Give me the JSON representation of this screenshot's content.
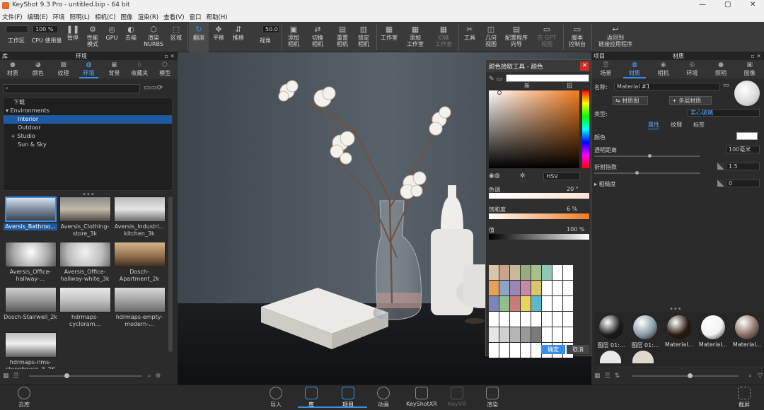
{
  "window": {
    "title": "KeyShot 9.3 Pro - untitled.bip - 64 bit",
    "controls": [
      "—",
      "▢",
      "✕"
    ]
  },
  "menu": [
    "文件(F)",
    "编辑(E)",
    "环境",
    "照明(L)",
    "相机(C)",
    "图像",
    "渲染(R)",
    "查看(V)",
    "窗口",
    "帮助(H)"
  ],
  "toolbar": {
    "cpu_value": "100 %",
    "fov_value": "50.0",
    "buttons": [
      {
        "label": "工作区",
        "icon": "workspace-icon"
      },
      {
        "label": "CPU 使用量",
        "icon": "cpu-icon"
      },
      {
        "label": "暂停",
        "icon": "pause-icon"
      },
      {
        "label": "性能\n模式",
        "icon": "performance-icon"
      },
      {
        "label": "GPU",
        "icon": "gpu-icon"
      },
      {
        "label": "去噪",
        "icon": "denoise-icon"
      },
      {
        "label": "渲染\nNURBS",
        "icon": "nurbs-icon"
      },
      {
        "label": "区域",
        "icon": "region-icon"
      },
      {
        "label": "翻滚",
        "icon": "tumble-icon"
      },
      {
        "label": "平移",
        "icon": "pan-icon"
      },
      {
        "label": "推移",
        "icon": "dolly-icon"
      },
      {
        "label": "视角",
        "icon": "fov-icon"
      },
      {
        "label": "添加\n相机",
        "icon": "add-camera-icon"
      },
      {
        "label": "切换\n相机",
        "icon": "switch-camera-icon"
      },
      {
        "label": "重置\n相机",
        "icon": "reset-camera-icon"
      },
      {
        "label": "锁定\n相机",
        "icon": "lock-camera-icon"
      },
      {
        "label": "工作室",
        "icon": "studio-icon"
      },
      {
        "label": "添加\n工作室",
        "icon": "add-studio-icon"
      },
      {
        "label": "切换\n工作室",
        "icon": "switch-studio-icon"
      },
      {
        "label": "工具",
        "icon": "tools-icon"
      },
      {
        "label": "几何\n视图",
        "icon": "geometry-view-icon"
      },
      {
        "label": "配置程序\n向导",
        "icon": "configurator-icon"
      },
      {
        "label": "在 GPT\n视图",
        "icon": "gpt-view-icon"
      },
      {
        "label": "脚本\n控制台",
        "icon": "script-console-icon"
      },
      {
        "label": "返回到\n链接应用程序",
        "icon": "return-link-icon"
      }
    ]
  },
  "library": {
    "title": "库",
    "panel_title": "环境",
    "tabs": [
      "材质",
      "颜色",
      "纹理",
      "环境",
      "背景",
      "收藏夹",
      "模型"
    ],
    "selected_tab": "环境",
    "tree_header": "下载",
    "tree": [
      "Environments",
      "Interior",
      "Outdoor",
      "Studio",
      "Sun & Sky"
    ],
    "selected_tree": "Interior",
    "thumbs": [
      "Aversis_Bathroo...",
      "Aversis_Clothing-store_3k",
      "Aversis_Industri... kitchen_3k",
      "Aversis_Office-hallway-...",
      "Aversis_Office-hallway-white_3k",
      "Dosch-Apartment_2k",
      "Dosch-Stairwell_2k",
      "hdrmaps-cycloram...",
      "hdrmaps-empty-modern-...",
      "hdrmaps-rims-stonehouse_3_2K"
    ]
  },
  "picker": {
    "title": "颜色拾取工具 - 颜色",
    "new_label": "新",
    "old_label": "旧",
    "mode": "HSV",
    "hue_label": "色调",
    "hue_value": "20 °",
    "sat_label": "饱和度",
    "sat_value": "6 %",
    "val_label": "值",
    "val_value": "100 %",
    "ok": "确定",
    "cancel": "取消",
    "swatch_colors": [
      "#d9c6a8",
      "#c9a48a",
      "#c7b99a",
      "#9aab7e",
      "#a8c08a",
      "#8fc7b8",
      "#ffffff",
      "#ffffff",
      "#e3a15a",
      "#8fa3c9",
      "#9a86b4",
      "#c48aa7",
      "#d8c86a",
      "#ffffff",
      "#ffffff",
      "#ffffff",
      "#7e86b8",
      "#8fc08a",
      "#c97a7a",
      "#e6d75a",
      "#5fb8c9",
      "#ffffff",
      "#ffffff",
      "#ffffff",
      "#ffffff",
      "#ffffff",
      "#ffffff",
      "#ffffff",
      "#ffffff",
      "#ffffff",
      "#ffffff",
      "#ffffff",
      "#e6e6e6",
      "#d0d0d0",
      "#b4b4b4",
      "#999999",
      "#7a7a7a",
      "#ffffff",
      "#ffffff",
      "#ffffff",
      "#ffffff",
      "#ffffff",
      "#ffffff",
      "#ffffff",
      "#ffffff",
      "#ffffff",
      "#ffffff",
      "#ffffff"
    ]
  },
  "project": {
    "title": "项目",
    "panel_title": "材质",
    "tabs": [
      "场景",
      "材质",
      "相机",
      "环境",
      "照明",
      "图像"
    ],
    "selected_tab": "材质",
    "name_label": "名称:",
    "name_value": "Material #1",
    "material_graph": "材质图",
    "multi_material": "多层材质",
    "type_label": "类型:",
    "type_value": "实心玻璃",
    "subtabs": [
      "属性",
      "纹理",
      "标签"
    ],
    "color_label": "颜色",
    "transmission_label": "透明距离",
    "transmission_value": "100毫米",
    "ior_label": "折射指数",
    "ior_value": "1.5",
    "roughness_label": "粗糙度",
    "roughness_value": "0",
    "materials": [
      "图层 01:...",
      "图层 01:...",
      "Material...",
      "Material...",
      "Material..."
    ],
    "material_colors": [
      "#1a1a1a",
      "#8a9aa6",
      "#2a1a10",
      "#f2f2f2",
      "#8a6f66"
    ]
  },
  "bottom": {
    "buttons": [
      "云库",
      "导入",
      "库",
      "项目",
      "动画",
      "KeyShotXR",
      "KeyVR",
      "渲染",
      "截屏"
    ],
    "selected": [
      "库",
      "项目"
    ]
  },
  "colors": {
    "accent": "#3b8ee6",
    "arrow": "#e53935"
  }
}
